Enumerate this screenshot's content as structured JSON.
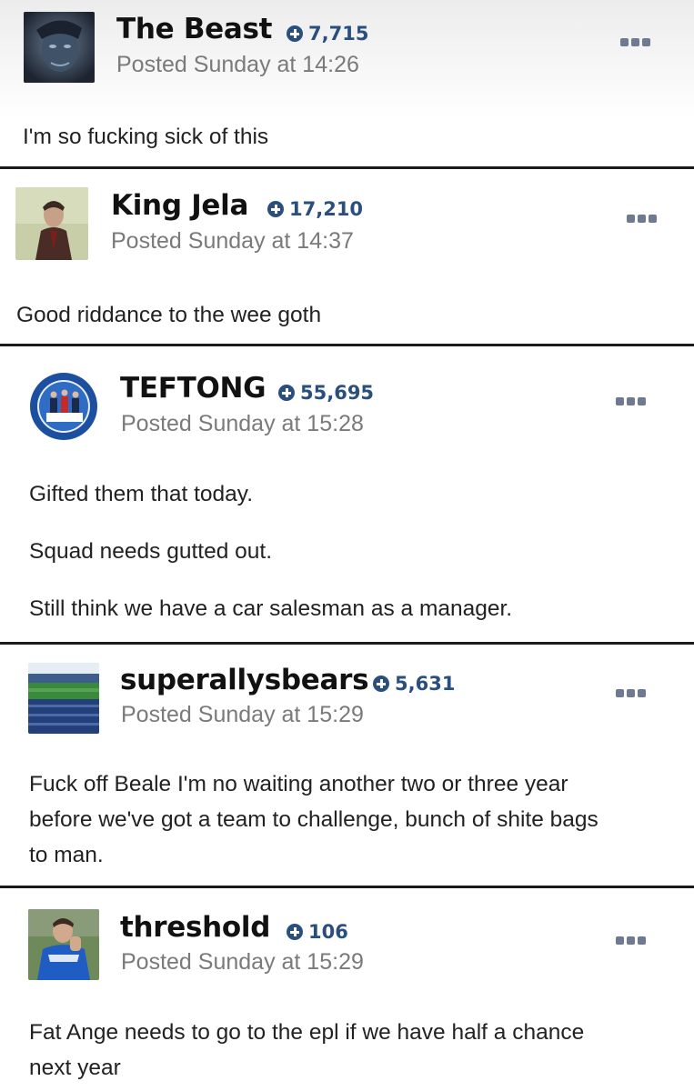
{
  "posts": [
    {
      "username": "The Beast",
      "reputation": "7,715",
      "posted": "Posted Sunday at 14:26",
      "avatar": "x-men-beast-avatar",
      "body": [
        "I'm so fucking sick of this"
      ]
    },
    {
      "username": "King Jela",
      "reputation": "17,210",
      "posted": "Posted Sunday at 14:37",
      "avatar": "man-in-jacket-avatar",
      "body": [
        "Good riddance to the wee goth"
      ]
    },
    {
      "username": "TEFTONG",
      "reputation": "55,695",
      "posted": "Posted Sunday at 15:28",
      "avatar": "rangers-football-crest-avatar",
      "body": [
        "Gifted them that today.",
        "Squad needs gutted out.",
        "Still think we have a car salesman as a manager."
      ]
    },
    {
      "username": "superallysbears",
      "reputation": "5,631",
      "posted": "Posted Sunday at 15:29",
      "avatar": "stadium-avatar",
      "body": [
        "Fuck off Beale I'm no waiting another two or three year",
        "before we've got a team to challenge, bunch of shite bags",
        "to man."
      ]
    },
    {
      "username": "threshold",
      "reputation": "106",
      "posted": "Posted Sunday at 15:29",
      "avatar": "footballer-kissing-badge-avatar",
      "body": [
        "Fat Ange needs to go to the epl if we have half a chance",
        "next year"
      ]
    }
  ],
  "colors": {
    "reputation": "#2a4f7e",
    "meta": "#7a7a7a",
    "divider": "#1a1a1a",
    "more_icon": "#6e7a92"
  },
  "icons": {
    "reputation": "plus-circle-icon",
    "more": "ellipsis-icon"
  }
}
